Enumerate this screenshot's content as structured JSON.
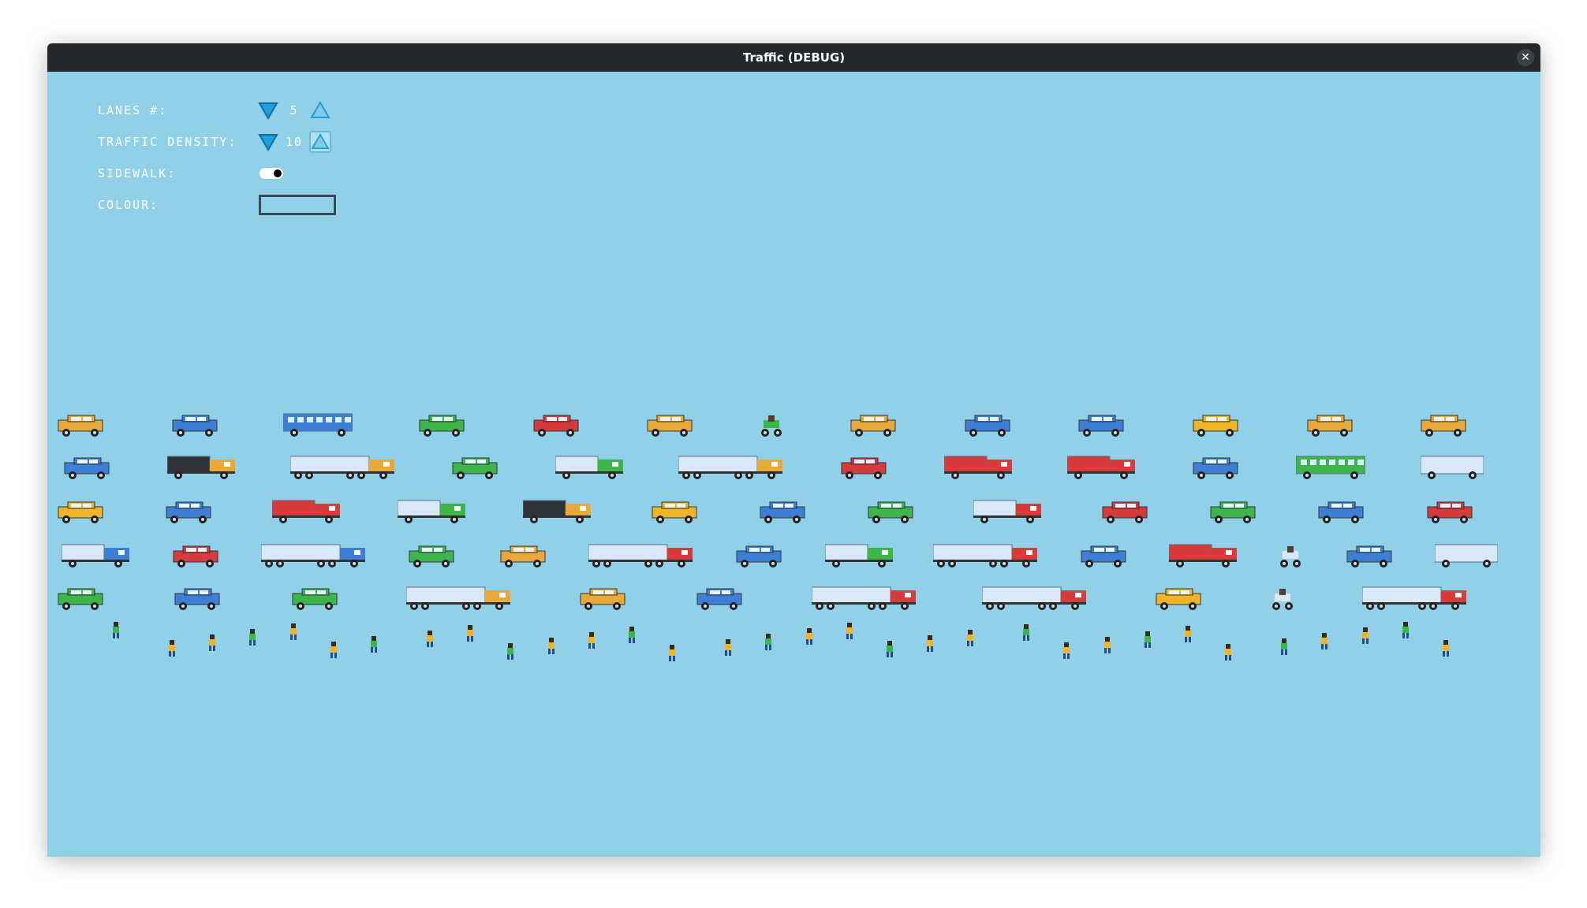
{
  "window": {
    "title": "Traffic (DEBUG)"
  },
  "settings": {
    "lanes": {
      "label": "LANES #:",
      "value": "5"
    },
    "density": {
      "label": "TRAFFIC DENSITY:",
      "value": "10"
    },
    "sidewalk": {
      "label": "SIDEWALK:",
      "on": true
    },
    "colour": {
      "label": "COLOUR:"
    }
  },
  "colors": {
    "sky": "#90d0e8",
    "titlebar": "#22282c",
    "arrow": "#1e9fd9",
    "red": "#d63a3a",
    "blue": "#3d7fd6",
    "green": "#3cb54a",
    "yellow": "#f0b428",
    "orange": "#e8a83a",
    "dark": "#2e3338",
    "trailer": "#d8e8f8"
  },
  "icons": {
    "down_arrow": "triangle-down-icon",
    "up_arrow": "triangle-up-icon",
    "close": "close-icon"
  },
  "traffic": {
    "lanes": [
      [
        "car-orange",
        "car-blue-tow",
        "bus-blue",
        "car-green",
        "car-red",
        "suv-orange",
        "car-green-small",
        "car-orange",
        "police-car",
        "car-blue",
        "taxi",
        "car-orange",
        "suv-orange"
      ],
      [
        "car-blue",
        "truck-dark-orange",
        "semi-orange",
        "car-green",
        "truck-green",
        "semi-orange",
        "car-red",
        "tow-red",
        "tow-red",
        "car-blue",
        "bus-green",
        "trailer-white"
      ],
      [
        "car-yellow",
        "car-blue",
        "firetruck",
        "truck-green",
        "truck-dark-orange",
        "taxi",
        "car-blue-tow",
        "car-green",
        "truck-red",
        "car-red",
        "car-green",
        "police-blue",
        "car-red"
      ],
      [
        "truck-blue",
        "car-red",
        "semi-blue",
        "car-green",
        "car-orange",
        "semi-red",
        "car-blue",
        "truck-green",
        "semi-red",
        "car-blue",
        "ambulance",
        "scooter",
        "police-blue",
        "trailer-white"
      ],
      [
        "car-green",
        "car-blue",
        "suv-green",
        "semi-orange",
        "car-orange",
        "car-blue",
        "semi-red",
        "semi-red",
        "taxi",
        "motorbike",
        "semi-red"
      ]
    ],
    "pedestrians": 32
  }
}
